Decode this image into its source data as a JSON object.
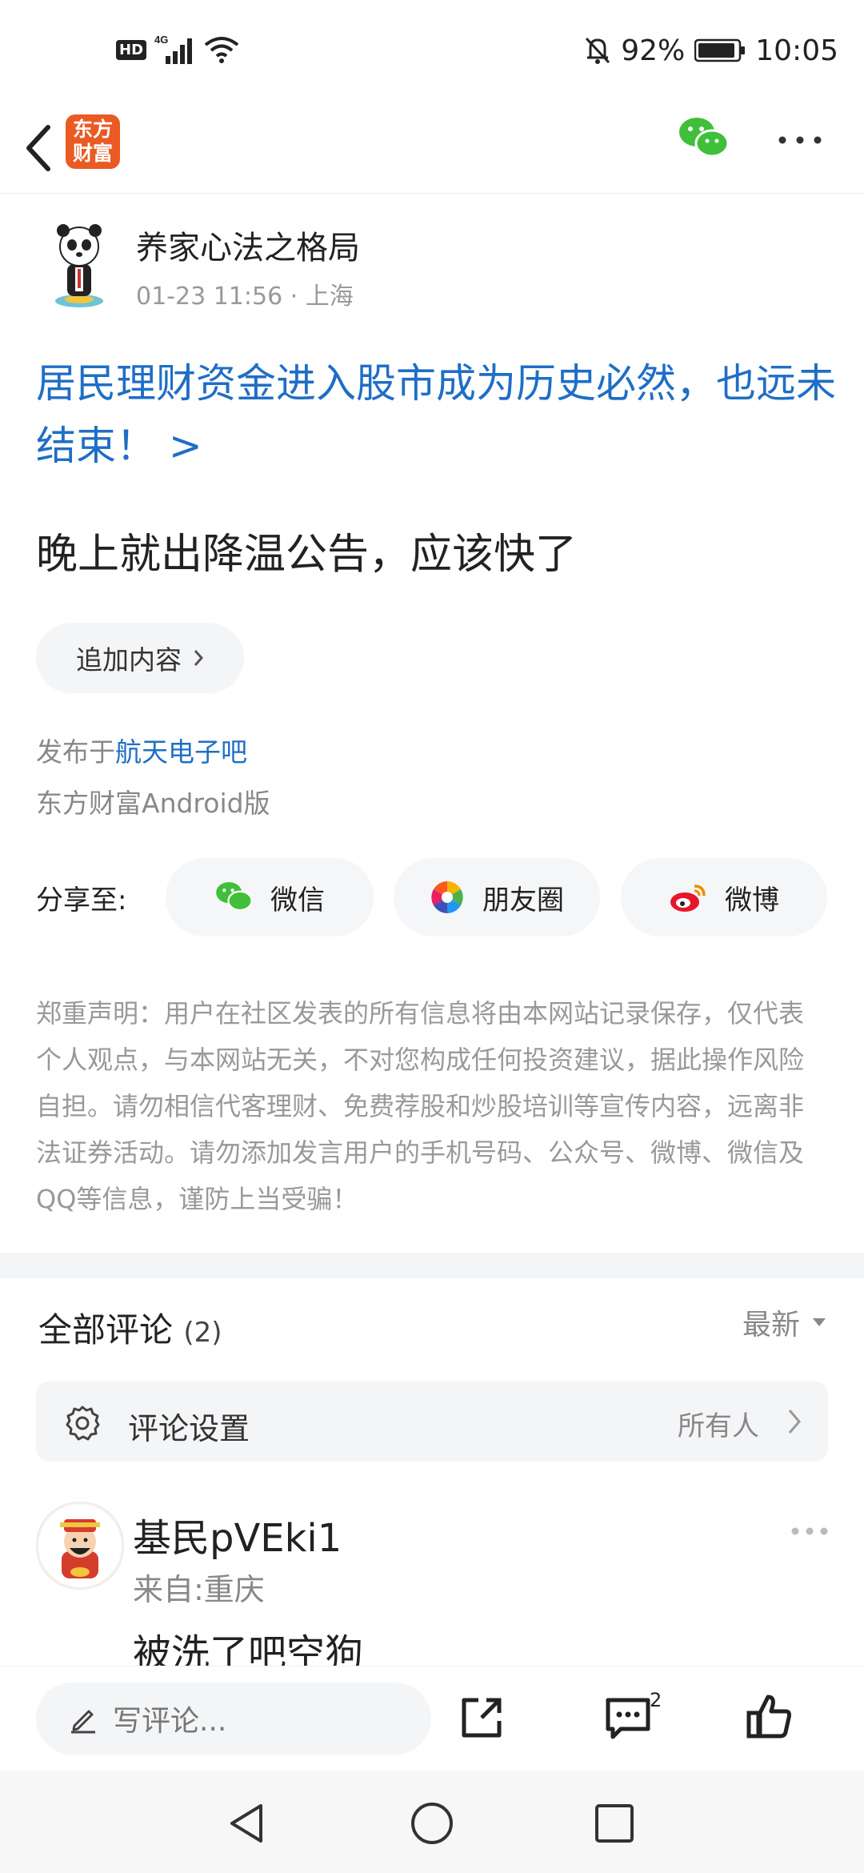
{
  "status": {
    "hd": "HD",
    "network": "4G",
    "battery": "92%",
    "time": "10:05"
  },
  "header": {
    "logo_line1": "东方",
    "logo_line2": "财富"
  },
  "post": {
    "author": "养家心法之格局",
    "meta": "01-23 11:56 · 上海",
    "title": "居民理财资金进入股市成为历史必然，也远未结束！ >",
    "body": "晚上就出降温公告，应该快了",
    "add_content": "追加内容",
    "published_prefix": "发布于",
    "published_forum": "航天电子吧",
    "client": "东方财富Android版"
  },
  "share": {
    "label": "分享至:",
    "items": [
      {
        "label": "微信"
      },
      {
        "label": "朋友圈"
      },
      {
        "label": "微博"
      }
    ]
  },
  "disclaimer": "郑重声明：用户在社区发表的所有信息将由本网站记录保存，仅代表个人观点，与本网站无关，不对您构成任何投资建议，据此操作风险自担。请勿相信代客理财、免费荐股和炒股培训等宣传内容，远离非法证券活动。请勿添加发言用户的手机号码、公众号、微博、微信及QQ等信息，谨防上当受骗！",
  "comments": {
    "title": "全部评论",
    "count": "(2)",
    "sort": "最新",
    "settings_label": "评论设置",
    "settings_value": "所有人",
    "items": [
      {
        "name": "基民pVEki1",
        "location": "来自:重庆",
        "text": "被洗了吧空狗"
      }
    ]
  },
  "bottom": {
    "write_placeholder": "写评论...",
    "comment_badge": "2"
  },
  "colors": {
    "link_blue": "#1f6ec6",
    "brand_orange": "#ea5a23",
    "wechat_green": "#3fbf3a"
  }
}
